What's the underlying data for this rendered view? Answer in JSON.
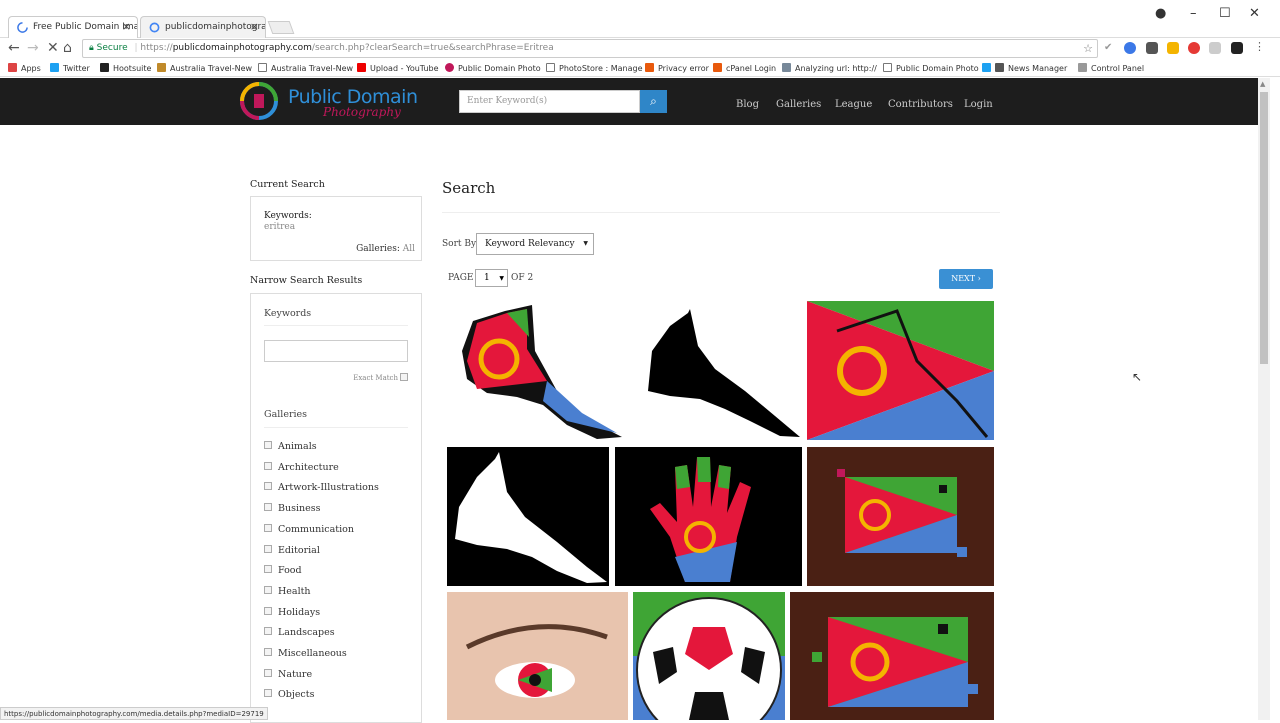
{
  "browser": {
    "tabs": [
      {
        "title": "Free Public Domain Imag"
      },
      {
        "title": "publicdomainphotograp"
      }
    ],
    "url_scheme": "https://",
    "url_host": "publicdomainphotography.com",
    "url_path": "/search.php?clearSearch=true&searchPhrase=Eritrea",
    "secure_label": "Secure",
    "bookmarks": [
      "Apps",
      "Twitter",
      "Hootsuite",
      "Australia Travel-New",
      "Australia Travel-New",
      "Upload - YouTube",
      "Public Domain Photo",
      "PhotoStore : Manage",
      "Privacy error",
      "cPanel Login",
      "Analyzing url: http://",
      "Public Domain Photo",
      "News Manager",
      "Control Panel"
    ],
    "status_url": "https://publicdomainphotography.com/media.details.php?mediaID=29719"
  },
  "site": {
    "logo_line1": "Public Domain",
    "logo_line2": "Photography",
    "search_placeholder": "Enter Keyword(s)",
    "nav": [
      "Blog",
      "Galleries",
      "League",
      "Contributors",
      "Login"
    ]
  },
  "sidebar": {
    "current_search_title": "Current Search",
    "keywords_label": "Keywords:",
    "keywords_value": "eritrea",
    "galleries_label": "Galleries:",
    "galleries_value": "All",
    "narrow_title": "Narrow Search Results",
    "keywords_heading": "Keywords",
    "exact_match_label": "Exact Match",
    "galleries_heading": "Galleries",
    "galleries": [
      "Animals",
      "Architecture",
      "Artwork-Illustrations",
      "Business",
      "Communication",
      "Editorial",
      "Food",
      "Health",
      "Holidays",
      "Landscapes",
      "Miscellaneous",
      "Nature",
      "Objects"
    ]
  },
  "main": {
    "title": "Search",
    "sort_label": "Sort By",
    "sort_value": "Keyword Relevancy",
    "page_label": "PAGE",
    "page_value": "1",
    "page_of": "OF 2",
    "next_label": "NEXT ›"
  },
  "colors": {
    "eritrea_green": "#3fa535",
    "eritrea_red": "#e4173b",
    "eritrea_blue": "#4a7fd0",
    "eritrea_gold": "#f4b400",
    "header_bg": "#1d1d1d",
    "accent_blue": "#3a90d4"
  }
}
